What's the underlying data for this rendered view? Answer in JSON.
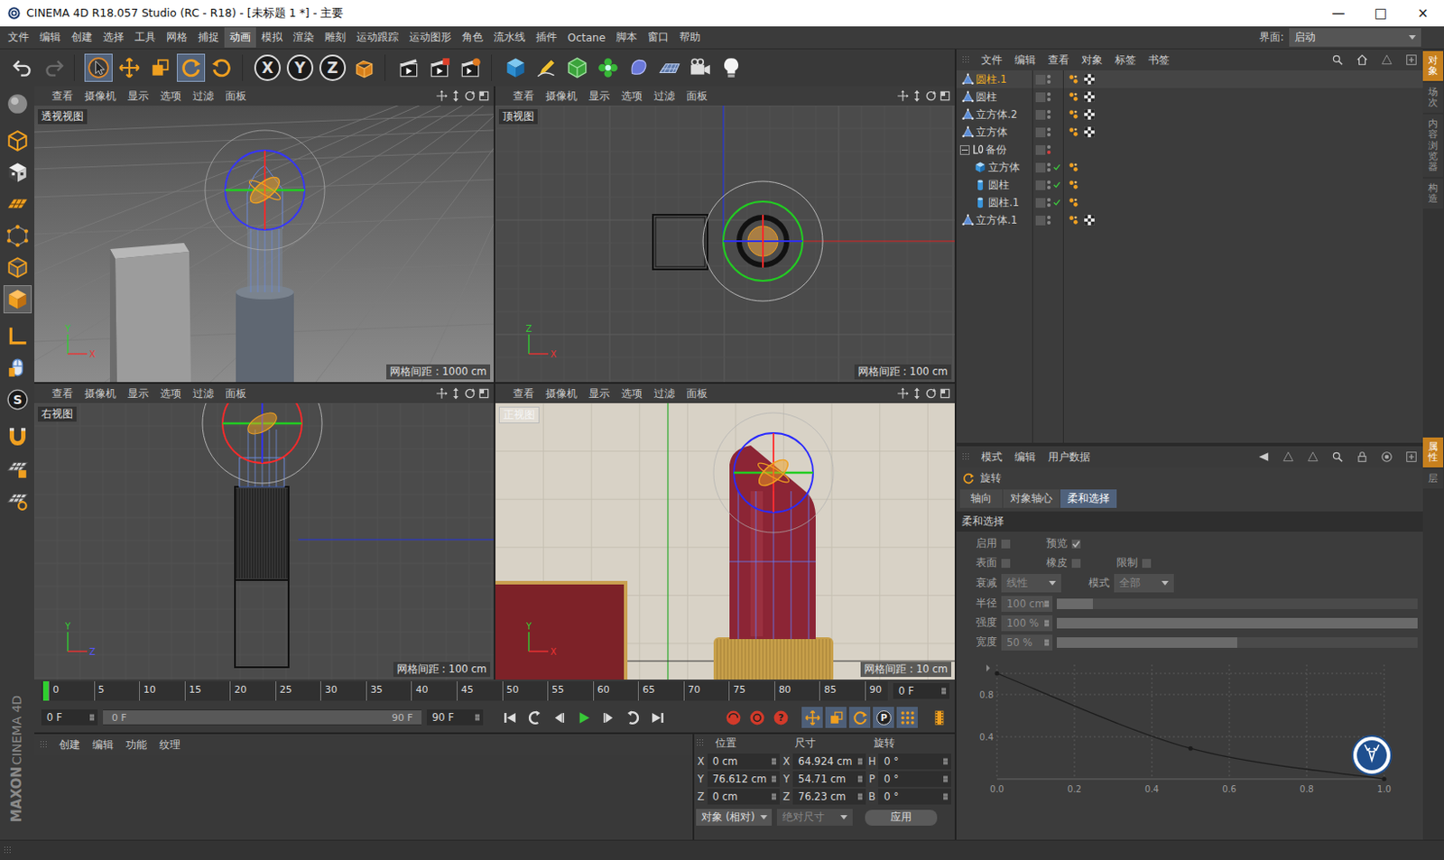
{
  "window": {
    "title": "CINEMA 4D R18.057 Studio (RC - R18) - [未标题 1 *] - 主要",
    "controls": [
      "—",
      "□",
      "×"
    ]
  },
  "menu": [
    {
      "label": "文件",
      "selected": false
    },
    {
      "label": "编辑",
      "selected": false
    },
    {
      "label": "创建",
      "selected": false
    },
    {
      "label": "选择",
      "selected": false
    },
    {
      "label": "工具",
      "selected": false
    },
    {
      "label": "网格",
      "selected": false
    },
    {
      "label": "捕捉",
      "selected": false
    },
    {
      "label": "动画",
      "selected": true
    },
    {
      "label": "模拟",
      "selected": false
    },
    {
      "label": "渲染",
      "selected": false
    },
    {
      "label": "雕刻",
      "selected": false
    },
    {
      "label": "运动跟踪",
      "selected": false
    },
    {
      "label": "运动图形",
      "selected": false
    },
    {
      "label": "角色",
      "selected": false
    },
    {
      "label": "流水线",
      "selected": false
    },
    {
      "label": "插件",
      "selected": false
    },
    {
      "label": "Octane",
      "selected": false
    },
    {
      "label": "脚本",
      "selected": false
    },
    {
      "label": "窗口",
      "selected": false
    },
    {
      "label": "帮助",
      "selected": false
    }
  ],
  "layout_selector": {
    "label": "界面:",
    "value": "启动"
  },
  "toolbar": {
    "tools": [
      {
        "selected": false
      },
      {
        "selected": false
      },
      {
        "selected": true
      },
      {
        "selected": false
      },
      {
        "selected": false
      },
      {
        "selected": true
      },
      {
        "selected": false
      },
      {
        "selected": false
      },
      {
        "selected": false
      },
      {
        "selected": false
      },
      {
        "selected": false
      },
      {
        "selected": false
      },
      {
        "selected": false
      },
      {
        "selected": false
      },
      {
        "selected": false
      },
      {
        "selected": false
      },
      {
        "selected": false
      },
      {
        "selected": false
      },
      {
        "selected": false
      }
    ],
    "axes": [
      {
        "label": "X",
        "selected": true
      },
      {
        "label": "Y",
        "selected": true
      },
      {
        "label": "Z",
        "selected": true
      }
    ]
  },
  "left_tools": [
    {
      "selected": false
    },
    {
      "selected": false
    },
    {
      "selected": false
    },
    {
      "selected": false
    },
    {
      "selected": false
    },
    {
      "selected": false
    },
    {
      "selected": true
    },
    {
      "selected": false
    },
    {
      "selected": false
    },
    {
      "selected": false,
      "label": "S"
    },
    {
      "selected": false
    },
    {
      "selected": false
    },
    {
      "selected": false
    }
  ],
  "brand": {
    "maxon": "MAXON",
    "product": "CINEMA 4D"
  },
  "viewports": [
    {
      "name": "透视视图",
      "kind": "perspective",
      "menu": [
        "查看",
        "摄像机",
        "显示",
        "选项",
        "过滤",
        "面板"
      ],
      "grid": "网格间距 : 1000 cm",
      "axes": [
        "Y",
        "X"
      ]
    },
    {
      "name": "顶视图",
      "kind": "top",
      "menu": [
        "查看",
        "摄像机",
        "显示",
        "选项",
        "过滤",
        "面板"
      ],
      "grid": "网格间距 : 100 cm",
      "axes": [
        "Z",
        "X"
      ]
    },
    {
      "name": "右视图",
      "kind": "right",
      "menu": [
        "查看",
        "摄像机",
        "显示",
        "选项",
        "过滤",
        "面板"
      ],
      "grid": "网格间距 : 100 cm",
      "axes": [
        "Y",
        "Z"
      ]
    },
    {
      "name": "正视图",
      "kind": "front",
      "menu": [
        "查看",
        "摄像机",
        "显示",
        "选项",
        "过滤",
        "面板"
      ],
      "grid": "网格间距 : 10 cm",
      "axes": [
        "Y",
        "X"
      ]
    }
  ],
  "timeline": {
    "ticks": [
      "0",
      "5",
      "10",
      "15",
      "20",
      "25",
      "30",
      "35",
      "40",
      "45",
      "50",
      "55",
      "60",
      "65",
      "70",
      "75",
      "80",
      "85",
      "90"
    ],
    "playhead": 0,
    "frame_field": "0 F",
    "start_field": "0 F",
    "range": {
      "start": "0 F",
      "end": "90 F",
      "level_start": 0,
      "level_end": 1
    },
    "end_field": "90 F",
    "help": "?",
    "param_key": "P"
  },
  "materials": {
    "menu": [
      "创建",
      "编辑",
      "功能",
      "纹理"
    ]
  },
  "coordinates": {
    "headers": [
      "位置",
      "尺寸",
      "旋转"
    ],
    "rows": [
      {
        "pos_axis": "X",
        "pos": "0 cm",
        "size_axis": "X",
        "size": "64.924 cm",
        "rot_axis": "H",
        "rot": "0 °"
      },
      {
        "pos_axis": "Y",
        "pos": "76.612 cm",
        "size_axis": "Y",
        "size": "54.71 cm",
        "rot_axis": "P",
        "rot": "0 °"
      },
      {
        "pos_axis": "Z",
        "pos": "0 cm",
        "size_axis": "Z",
        "size": "76.23 cm",
        "rot_axis": "B",
        "rot": "0 °"
      }
    ],
    "mode": "对象 (相对)",
    "size_mode": {
      "label": "绝对尺寸",
      "disabled": true
    },
    "apply": "应用"
  },
  "objects": {
    "menu": [
      "文件",
      "编辑",
      "查看",
      "对象",
      "标签",
      "书签"
    ],
    "items": [
      {
        "name": "圆柱.1",
        "level": 0,
        "kind": "polygon",
        "selected": true,
        "expanded": false,
        "check": false,
        "phong": true,
        "material": true,
        "dots": [
          "#8a8a8a",
          "#8a8a8a"
        ]
      },
      {
        "name": "圆柱",
        "level": 0,
        "kind": "polygon",
        "selected": false,
        "expanded": false,
        "check": false,
        "phong": true,
        "material": true,
        "dots": [
          "#8a8a8a",
          "#8a8a8a"
        ]
      },
      {
        "name": "立方体.2",
        "level": 0,
        "kind": "polygon",
        "selected": false,
        "expanded": false,
        "check": false,
        "phong": true,
        "material": true,
        "dots": [
          "#8a8a8a",
          "#8a8a8a"
        ]
      },
      {
        "name": "立方体",
        "level": 0,
        "kind": "polygon",
        "selected": false,
        "expanded": false,
        "check": false,
        "phong": true,
        "material": true,
        "dots": [
          "#8a8a8a",
          "#8a8a8a"
        ]
      },
      {
        "name": "备份",
        "level": 0,
        "kind": "null",
        "selected": false,
        "expanded": true,
        "check": false,
        "phong": false,
        "material": false,
        "dots": [
          "#8a8a8a",
          "#d84040"
        ]
      },
      {
        "name": "立方体",
        "level": 1,
        "kind": "cube",
        "selected": false,
        "expanded": false,
        "check": true,
        "phong": true,
        "material": false,
        "dots": [
          "#8a8a8a",
          "#8a8a8a"
        ]
      },
      {
        "name": "圆柱",
        "level": 1,
        "kind": "cylinder",
        "selected": false,
        "expanded": false,
        "check": true,
        "phong": true,
        "material": false,
        "dots": [
          "#8a8a8a",
          "#8a8a8a"
        ]
      },
      {
        "name": "圆柱.1",
        "level": 1,
        "kind": "cylinder",
        "selected": false,
        "expanded": false,
        "check": true,
        "phong": true,
        "material": false,
        "dots": [
          "#8a8a8a",
          "#8a8a8a"
        ]
      },
      {
        "name": "立方体.1",
        "level": 0,
        "kind": "polygon",
        "selected": false,
        "expanded": false,
        "check": false,
        "phong": true,
        "material": true,
        "dots": [
          "#8a8a8a",
          "#8a8a8a"
        ]
      }
    ]
  },
  "attributes": {
    "menu": [
      "模式",
      "编辑",
      "用户数据"
    ],
    "title": "旋转",
    "tabs": [
      {
        "label": "轴向",
        "selected": false
      },
      {
        "label": "对象轴心",
        "selected": false
      },
      {
        "label": "柔和选择",
        "selected": true
      }
    ],
    "section": "柔和选择",
    "disabled": true,
    "checkbox_rows": [
      [
        {
          "label": "启用",
          "checked": false
        },
        {
          "label": "预览",
          "checked": true
        }
      ],
      [
        {
          "label": "表面",
          "checked": false
        },
        {
          "label": "橡皮",
          "checked": false
        },
        {
          "label": "限制",
          "checked": false
        }
      ]
    ],
    "dropdowns": [
      {
        "label": "衰减",
        "value": "线性"
      },
      {
        "label": "模式",
        "value": "全部"
      }
    ],
    "sliders": [
      {
        "label": "半径",
        "value": "100 cm",
        "level": 0.1
      },
      {
        "label": "强度",
        "value": "100 %",
        "level": 1
      },
      {
        "label": "宽度",
        "value": "50 %",
        "level": 0.5
      }
    ],
    "curve": {
      "x_ticks": [
        "0.0",
        "0.2",
        "0.4",
        "0.6",
        "0.8",
        "1.0"
      ],
      "y_ticks": [
        "0.8",
        "0.4"
      ],
      "series": [
        {
          "x": [
            0,
            0.5,
            1
          ],
          "values": [
            1,
            0.29,
            0
          ]
        }
      ]
    }
  },
  "side_tabs_top": [
    {
      "label": "对象",
      "selected": true
    },
    {
      "label": "场次",
      "selected": false
    },
    {
      "label": "内容浏览器",
      "selected": false
    },
    {
      "label": "构造",
      "selected": false
    }
  ],
  "side_tabs_bottom": [
    {
      "label": "属性",
      "selected": true
    },
    {
      "label": "层",
      "selected": false
    }
  ]
}
